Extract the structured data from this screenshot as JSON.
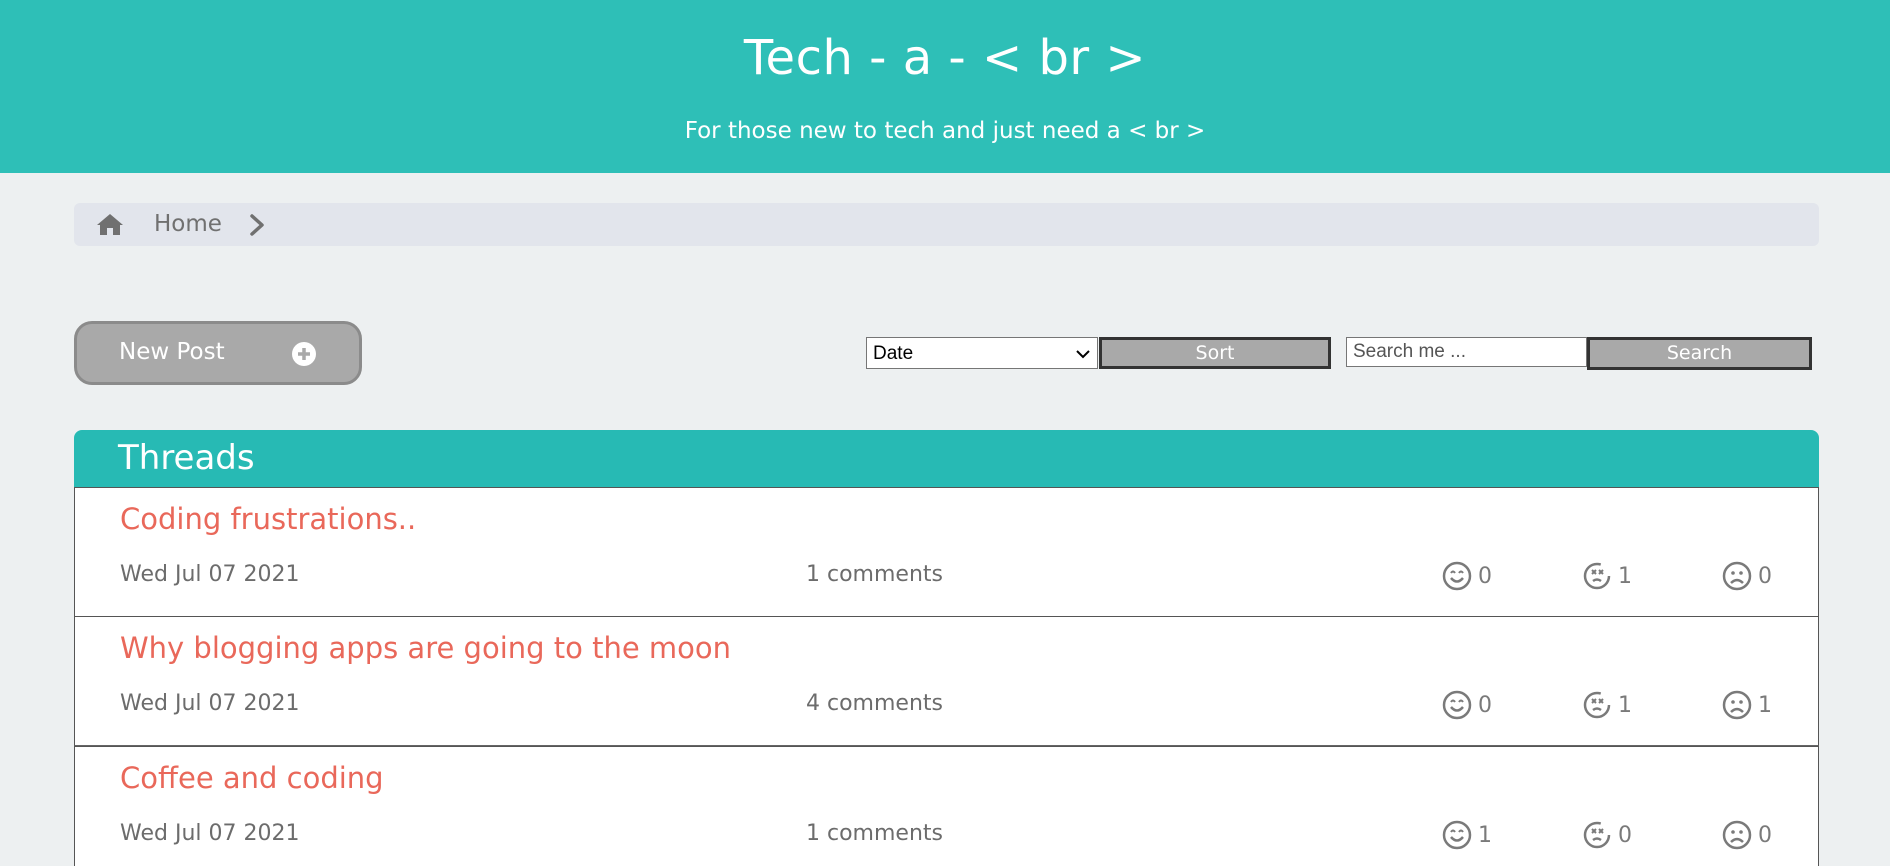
{
  "header": {
    "title": "Tech - a - < br >",
    "subtitle": "For those new to tech and just need a < br >"
  },
  "breadcrumb": {
    "home_label": "Home"
  },
  "toolbar": {
    "new_post_label": "New Post",
    "sort_selected": "Date",
    "sort_label": "Sort",
    "search_placeholder": "Search me ...",
    "search_label": "Search"
  },
  "threads": {
    "heading": "Threads",
    "items": [
      {
        "title": "Coding frustrations..",
        "date": "Wed Jul 07 2021",
        "comments": "1 comments",
        "happy": "0",
        "dizzy": "1",
        "sad": "0"
      },
      {
        "title": "Why blogging apps are going to the moon",
        "date": "Wed Jul 07 2021",
        "comments": "4 comments",
        "happy": "0",
        "dizzy": "1",
        "sad": "1"
      },
      {
        "title": "Coffee and coding",
        "date": "Wed Jul 07 2021",
        "comments": "1 comments",
        "happy": "1",
        "dizzy": "0",
        "sad": "0"
      }
    ]
  },
  "colors": {
    "header_bg": "#2ebfb7",
    "threads_header_bg": "#27bab4",
    "thread_title": "#e9685a",
    "page_bg": "#edf0f1"
  }
}
